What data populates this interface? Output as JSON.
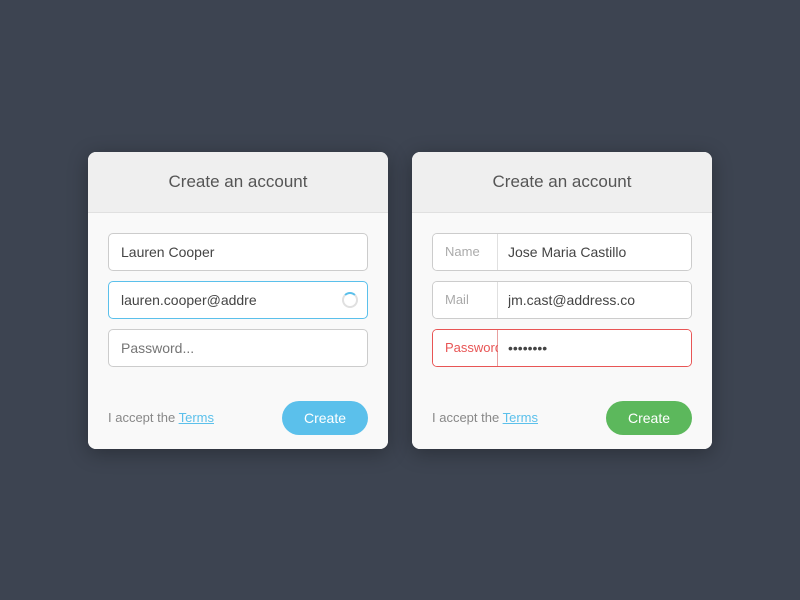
{
  "card1": {
    "title": "Create an account",
    "name_value": "Lauren Cooper",
    "email_value": "lauren.cooper@addre",
    "password_placeholder": "Password...",
    "accept_text": "I accept the ",
    "terms_label": "Terms",
    "create_label": "Create"
  },
  "card2": {
    "title": "Create an account",
    "name_label": "Name",
    "name_value": "Jose Maria Castillo",
    "mail_label": "Mail",
    "mail_value": "jm.cast@address.co",
    "password_label": "Password",
    "password_value": "••••••••",
    "accept_text": "I accept the ",
    "terms_label": "Terms",
    "create_label": "Create"
  },
  "colors": {
    "background": "#3d4451",
    "accent_blue": "#5bc0eb",
    "accent_green": "#5cb85c",
    "error_red": "#e85555"
  }
}
